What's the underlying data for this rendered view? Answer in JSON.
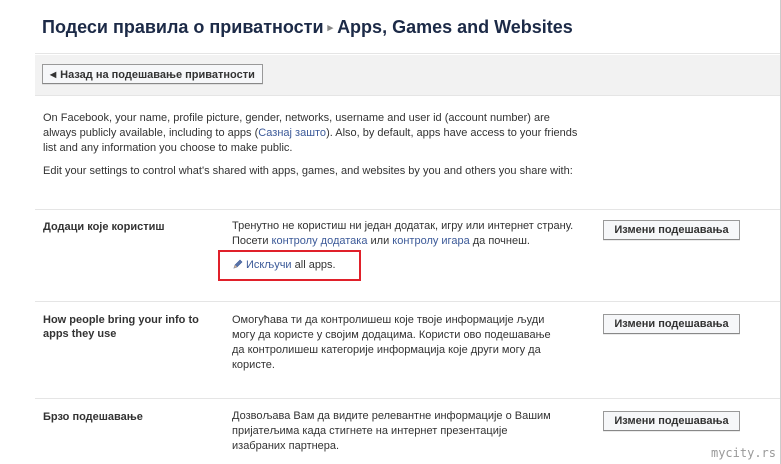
{
  "header": {
    "breadcrumb_parent": "Подеси правила о приватности",
    "breadcrumb_separator": "▸",
    "breadcrumb_current": "Apps, Games and Websites"
  },
  "back_button": {
    "label": "Назад на подешавање приватности"
  },
  "intro": {
    "text_before_link": "On Facebook, your name, profile picture, gender, networks, username and user id (account number) are always publicly available, including to apps (",
    "link_label": "Сазнај зашто",
    "text_after_link": "). Also, by default, apps have access to your friends list and any information you choose to make public.",
    "edit_line": "Edit your settings to control what's shared with apps, games, and websites by you and others you share with:"
  },
  "sections": [
    {
      "title": "Додаци које користиш",
      "desc_part1": "Тренутно не користиш ни један додатак, игру или интернет страну. Посети ",
      "link1": "контролу додатака",
      "desc_mid": " или ",
      "link2": "контролу игара",
      "desc_end": " да почнеш.",
      "disable_link": "Искључи",
      "disable_suffix": " all apps.",
      "button": "Измени подешавања"
    },
    {
      "title": "How people bring your info to apps they use",
      "desc": "Омогућава ти да контролишеш које твоје информације људи могу да користе у својим додацима. Користи ово подешавање да контролишеш категорије информација које други могу да користе.",
      "button": "Измени подешавања"
    },
    {
      "title": "Брзо подешавање",
      "desc": "Дозвољава Вам да видите релевантне информације о Вашим пријатељима када стигнете на интернет презентације изабраних партнера.",
      "button": "Измени подешавања"
    }
  ],
  "watermark": "mycity.rs",
  "colors": {
    "link": "#3b5998",
    "title": "#1c2a47",
    "highlight": "#e0202a",
    "back_bar": "#f2f2f2"
  },
  "icons": {
    "disable_link_icon": "pencil-icon",
    "back_button_icon": "left-triangle-icon"
  }
}
